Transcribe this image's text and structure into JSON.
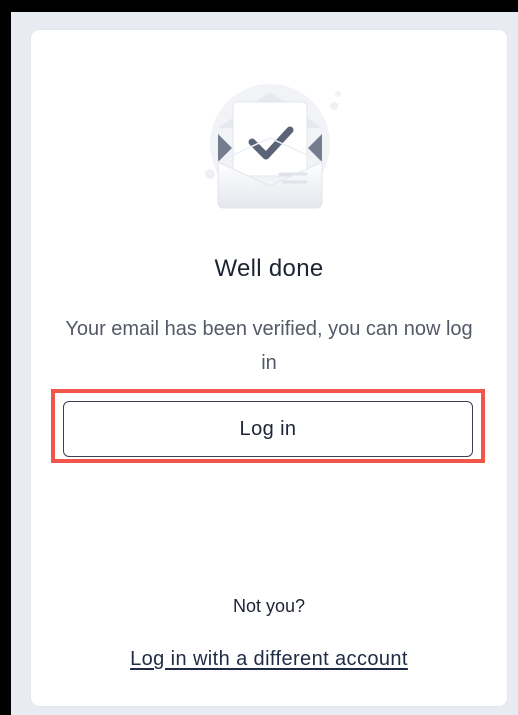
{
  "colors": {
    "accent_highlight": "#f0564a",
    "text_primary": "#1d2433",
    "text_secondary": "#535a66",
    "page_background": "#e8ebf1",
    "card_background": "#ffffff"
  },
  "card": {
    "illustration_icon": "envelope-check-icon",
    "title": "Well done",
    "message": "Your email has been verified, you can now log in",
    "login_button_label": "Log in",
    "not_you_text": "Not you?",
    "different_account_link": "Log in with a different account"
  }
}
